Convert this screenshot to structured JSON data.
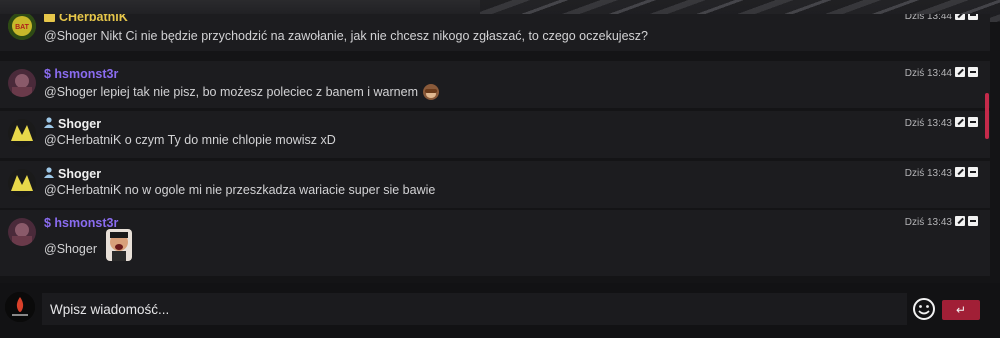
{
  "colors": {
    "accent": "#a11f36",
    "scroll_thumb": "#c42a4a",
    "purple_name": "#8a6cf0",
    "yellow_name": "#e6c64a"
  },
  "messages": [
    {
      "author": "CHerbatniK",
      "author_icon": "badge-icon",
      "text": "@Shoger Nikt Ci nie będzie przychodzić na zawołanie, jak nie chcesz nikogo zgłaszać, to czego oczekujesz?",
      "time": "Dziś 13:44"
    },
    {
      "author": "$ hsmonst3r",
      "text": "@Shoger lepiej tak nie pisz, bo możesz poleciec z banem i warnem",
      "emoji": "see-no-evil-monkey-icon",
      "time": "Dziś 13:44"
    },
    {
      "author": "Shoger",
      "author_icon": "user-icon",
      "text": "@CHerbatniK o czym Ty do mnie chlopie mowisz xD",
      "time": "Dziś 13:43"
    },
    {
      "author": "Shoger",
      "author_icon": "user-icon",
      "text": "@CHerbatniK no w ogole mi nie przeszkadza wariacie super sie bawie",
      "time": "Dziś 13:43"
    },
    {
      "author": "$ hsmonst3r",
      "text": "@Shoger",
      "emoji": "laughing-face-sticker",
      "time": "Dziś 13:43"
    }
  ],
  "composer": {
    "placeholder": "Wpisz wiadomość...",
    "send_label": "↵"
  }
}
